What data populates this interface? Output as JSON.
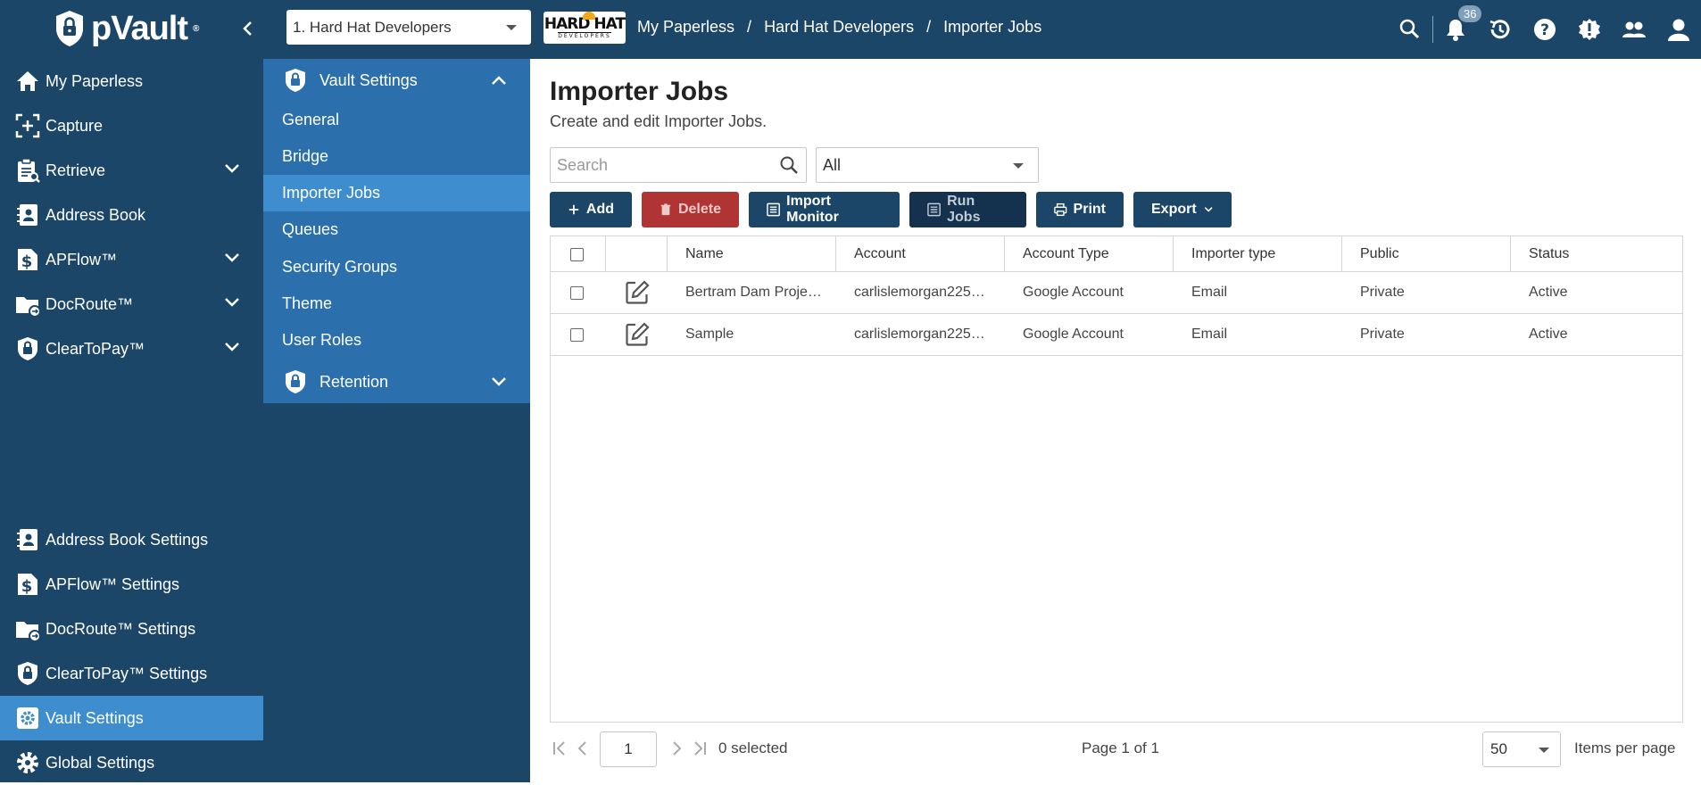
{
  "app": {
    "name": "pVault",
    "trademark": "®"
  },
  "header": {
    "org_select": "1. Hard Hat Developers",
    "brand_logo_line1": "HARD HAT",
    "brand_logo_line2": "DEVELOPERS",
    "breadcrumb": [
      "My Paperless",
      "Hard Hat Developers",
      "Importer Jobs"
    ],
    "breadcrumb_sep": "/",
    "notification_count": "36"
  },
  "sidebar": {
    "items": [
      {
        "label": "My Paperless",
        "icon": "home-icon"
      },
      {
        "label": "Capture",
        "icon": "capture-icon"
      },
      {
        "label": "Retrieve",
        "icon": "clipboard-search-icon",
        "expandable": true
      },
      {
        "label": "Address Book",
        "icon": "address-book-icon"
      },
      {
        "label": "APFlow™",
        "icon": "dollar-doc-icon",
        "expandable": true
      },
      {
        "label": "DocRoute™",
        "icon": "folder-route-icon",
        "expandable": true
      },
      {
        "label": "ClearToPay™",
        "icon": "shield-lock-icon",
        "expandable": true
      }
    ],
    "settings": [
      {
        "label": "Address Book Settings",
        "icon": "address-book-icon"
      },
      {
        "label": "APFlow™ Settings",
        "icon": "dollar-doc-icon"
      },
      {
        "label": "DocRoute™ Settings",
        "icon": "folder-route-icon"
      },
      {
        "label": "ClearToPay™ Settings",
        "icon": "shield-lock-icon"
      },
      {
        "label": "Vault Settings",
        "icon": "gear-box-icon",
        "active": true
      },
      {
        "label": "Global Settings",
        "icon": "gear-icon"
      }
    ]
  },
  "subpanel": {
    "header": "Vault Settings",
    "items": [
      "General",
      "Bridge",
      "Importer Jobs",
      "Queues",
      "Security Groups",
      "Theme",
      "User Roles"
    ],
    "active": "Importer Jobs",
    "retention": "Retention"
  },
  "main": {
    "title": "Importer Jobs",
    "subtitle": "Create and edit Importer Jobs.",
    "search_placeholder": "Search",
    "filter_value": "All",
    "buttons": {
      "add": "Add",
      "delete": "Delete",
      "import_monitor": "Import Monitor",
      "run_jobs": "Run Jobs",
      "print": "Print",
      "export": "Export"
    },
    "columns": [
      "Name",
      "Account",
      "Account Type",
      "Importer type",
      "Public",
      "Status"
    ],
    "rows": [
      [
        "Bertram Dam Proje…",
        "carlislemorgan225…",
        "Google Account",
        "Email",
        "Private",
        "Active"
      ],
      [
        "Sample",
        "carlislemorgan225…",
        "Google Account",
        "Email",
        "Private",
        "Active"
      ]
    ],
    "pager": {
      "page": "1",
      "selected": "0 selected",
      "page_of": "Page 1 of 1",
      "per_page": "50",
      "per_page_label": "Items per page"
    }
  }
}
